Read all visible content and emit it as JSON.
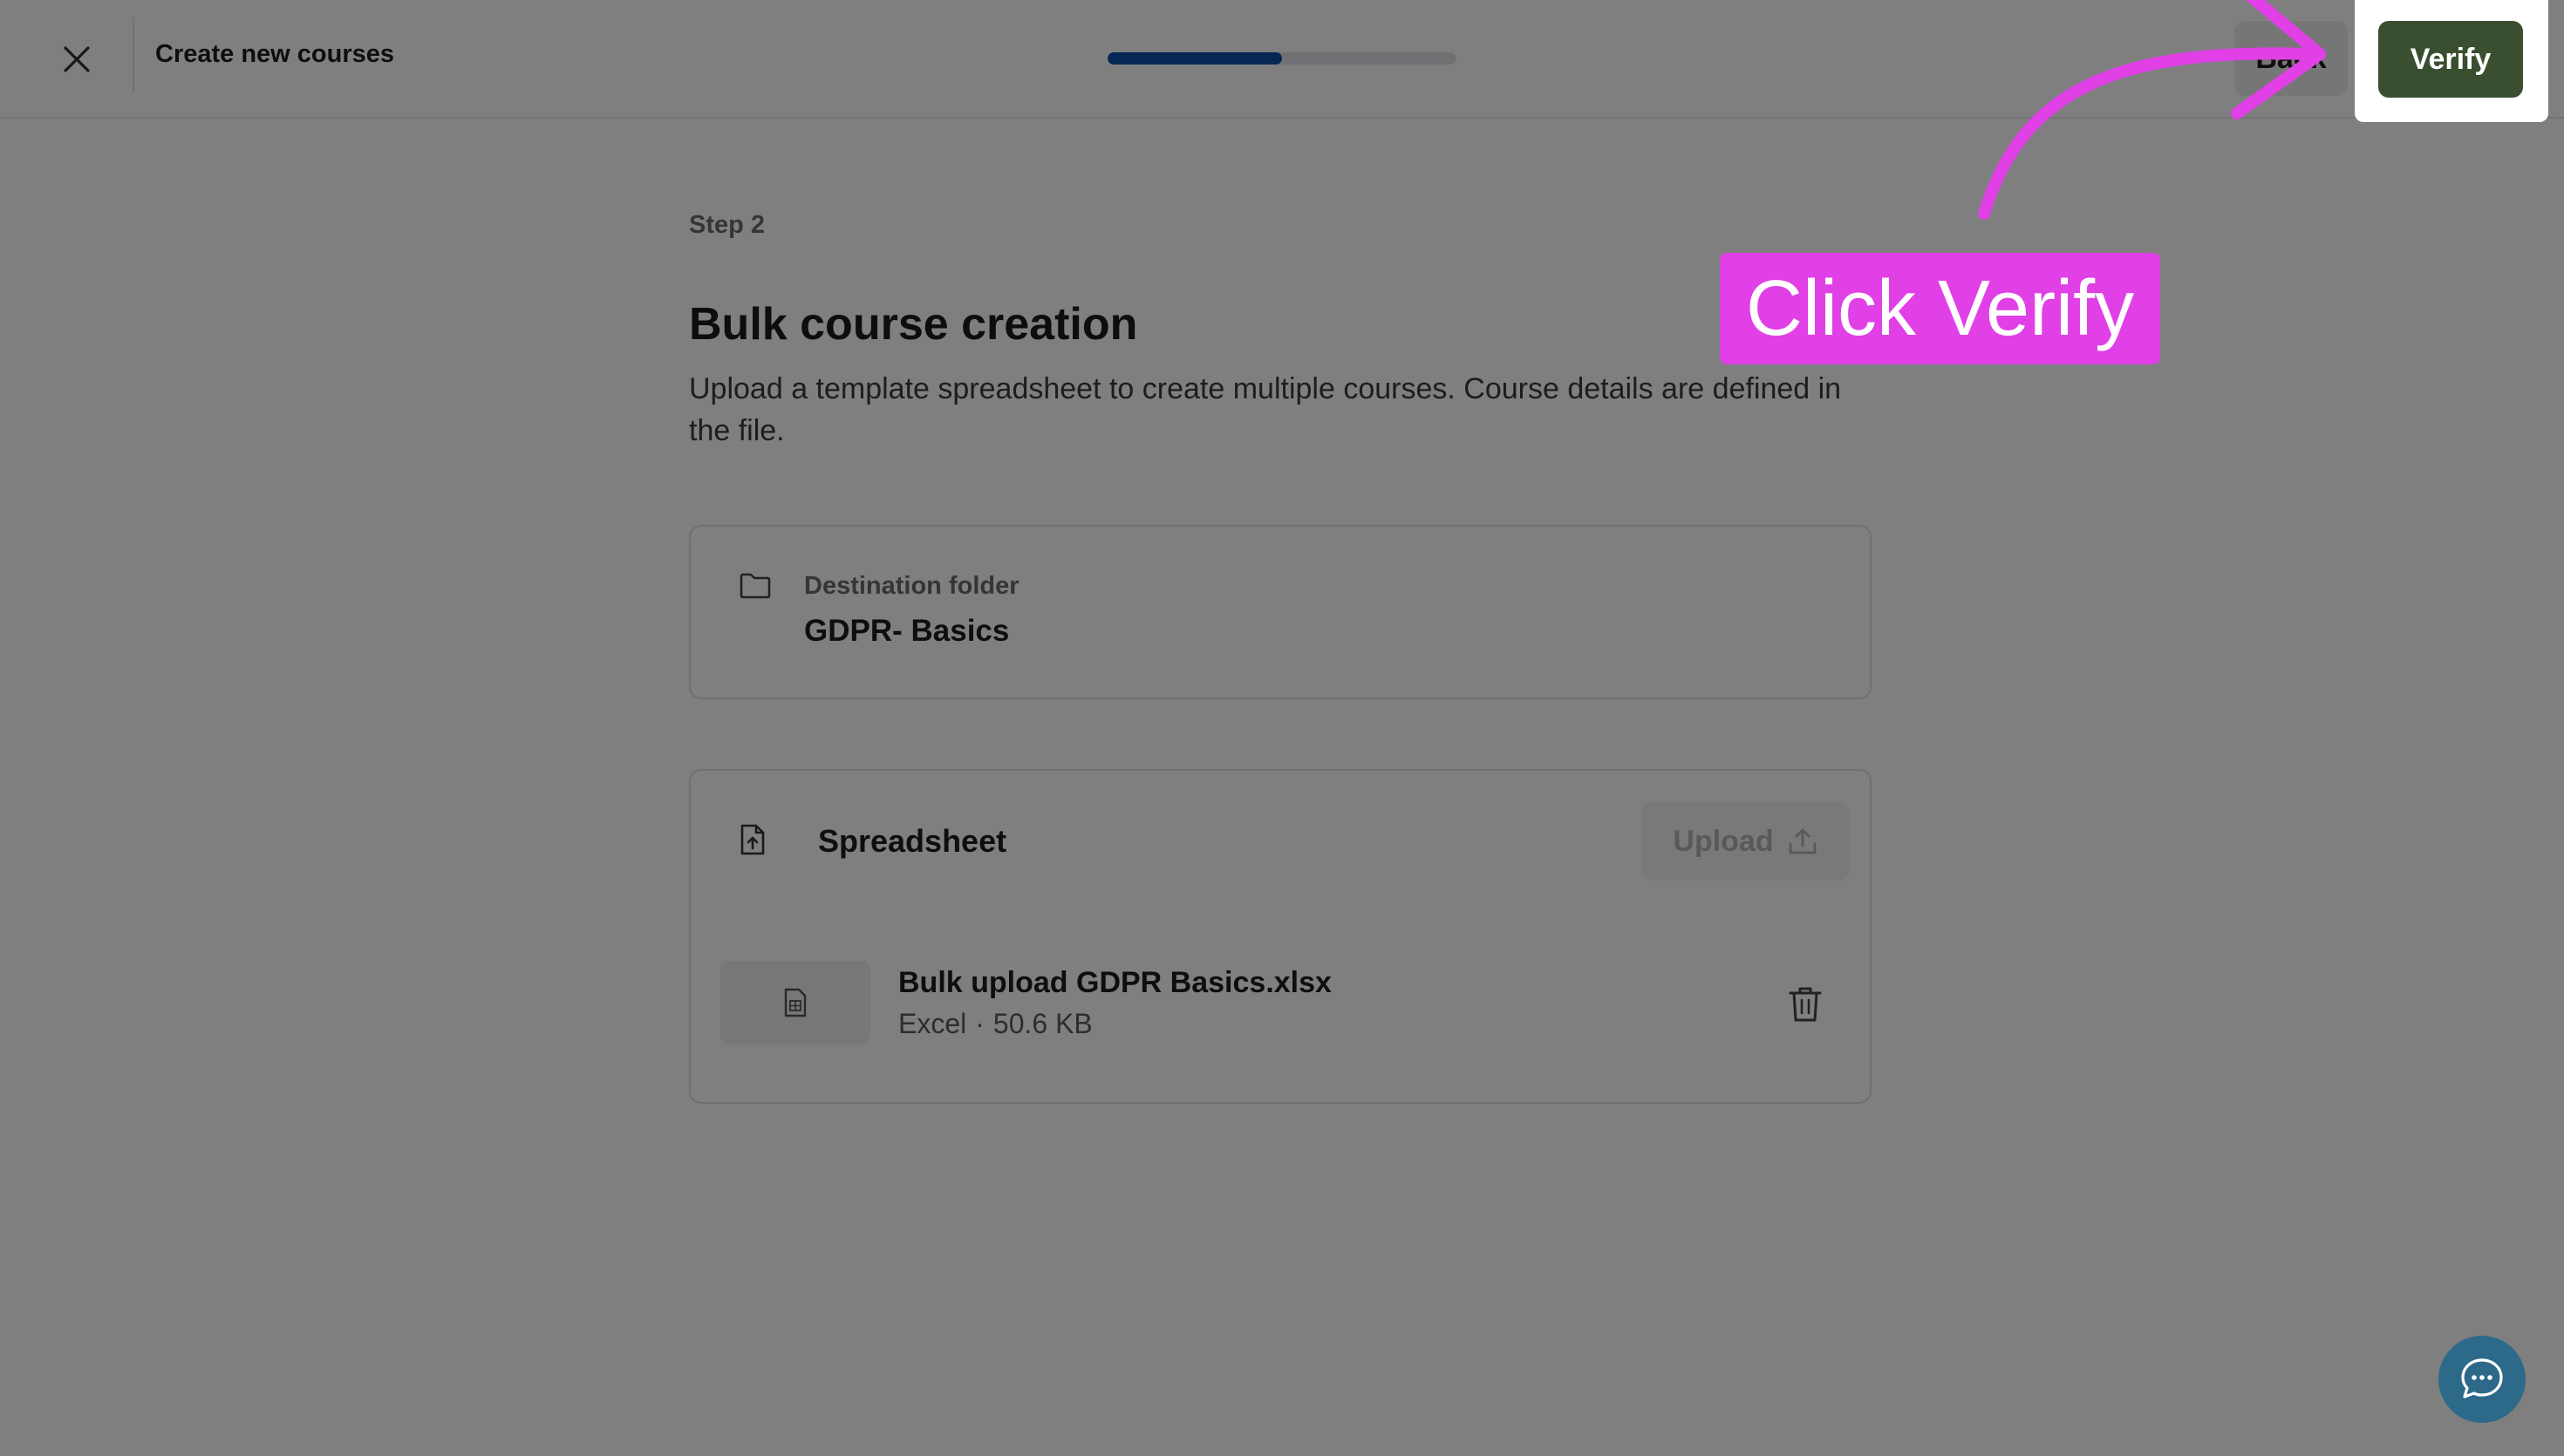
{
  "header": {
    "title": "Create new courses",
    "progress_fraction": 0.5,
    "back_label": "Back",
    "verify_label": "Verify"
  },
  "content": {
    "step_label": "Step 2",
    "title": "Bulk course creation",
    "description": "Upload a template spreadsheet to create multiple courses. Course details are defined in the file."
  },
  "destination": {
    "label": "Destination folder",
    "value": "GDPR- Basics"
  },
  "spreadsheet": {
    "label": "Spreadsheet",
    "upload_label": "Upload",
    "file": {
      "name": "Bulk upload GDPR Basics.xlsx",
      "type": "Excel",
      "separator": "·",
      "size": "50.6 KB"
    }
  },
  "annotation": {
    "text": "Click Verify",
    "color": "#e040e6"
  },
  "colors": {
    "accent_progress": "#0a4fa8",
    "verify_button": "#3a4e30",
    "chat_button": "#2d6a8a"
  },
  "icons": [
    "close-icon",
    "folder-icon",
    "spreadsheet-upload-icon",
    "upload-icon",
    "file-icon",
    "trash-icon",
    "chat-icon"
  ]
}
